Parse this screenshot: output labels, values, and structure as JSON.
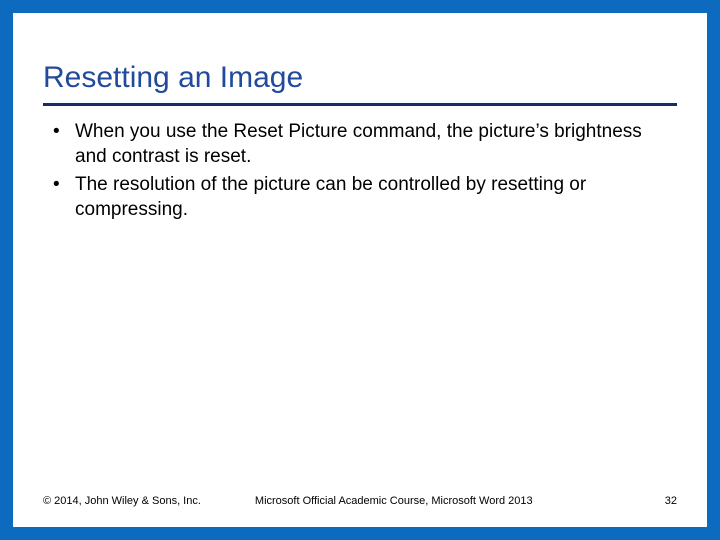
{
  "title": "Resetting an Image",
  "bullets": [
    "When you use the Reset Picture command, the picture’s brightness and contrast is reset.",
    "The resolution of the picture can be controlled by resetting or compressing."
  ],
  "footer": {
    "copyright": "© 2014, John Wiley & Sons, Inc.",
    "course": "Microsoft Official Academic Course, Microsoft Word 2013",
    "page": "32"
  }
}
